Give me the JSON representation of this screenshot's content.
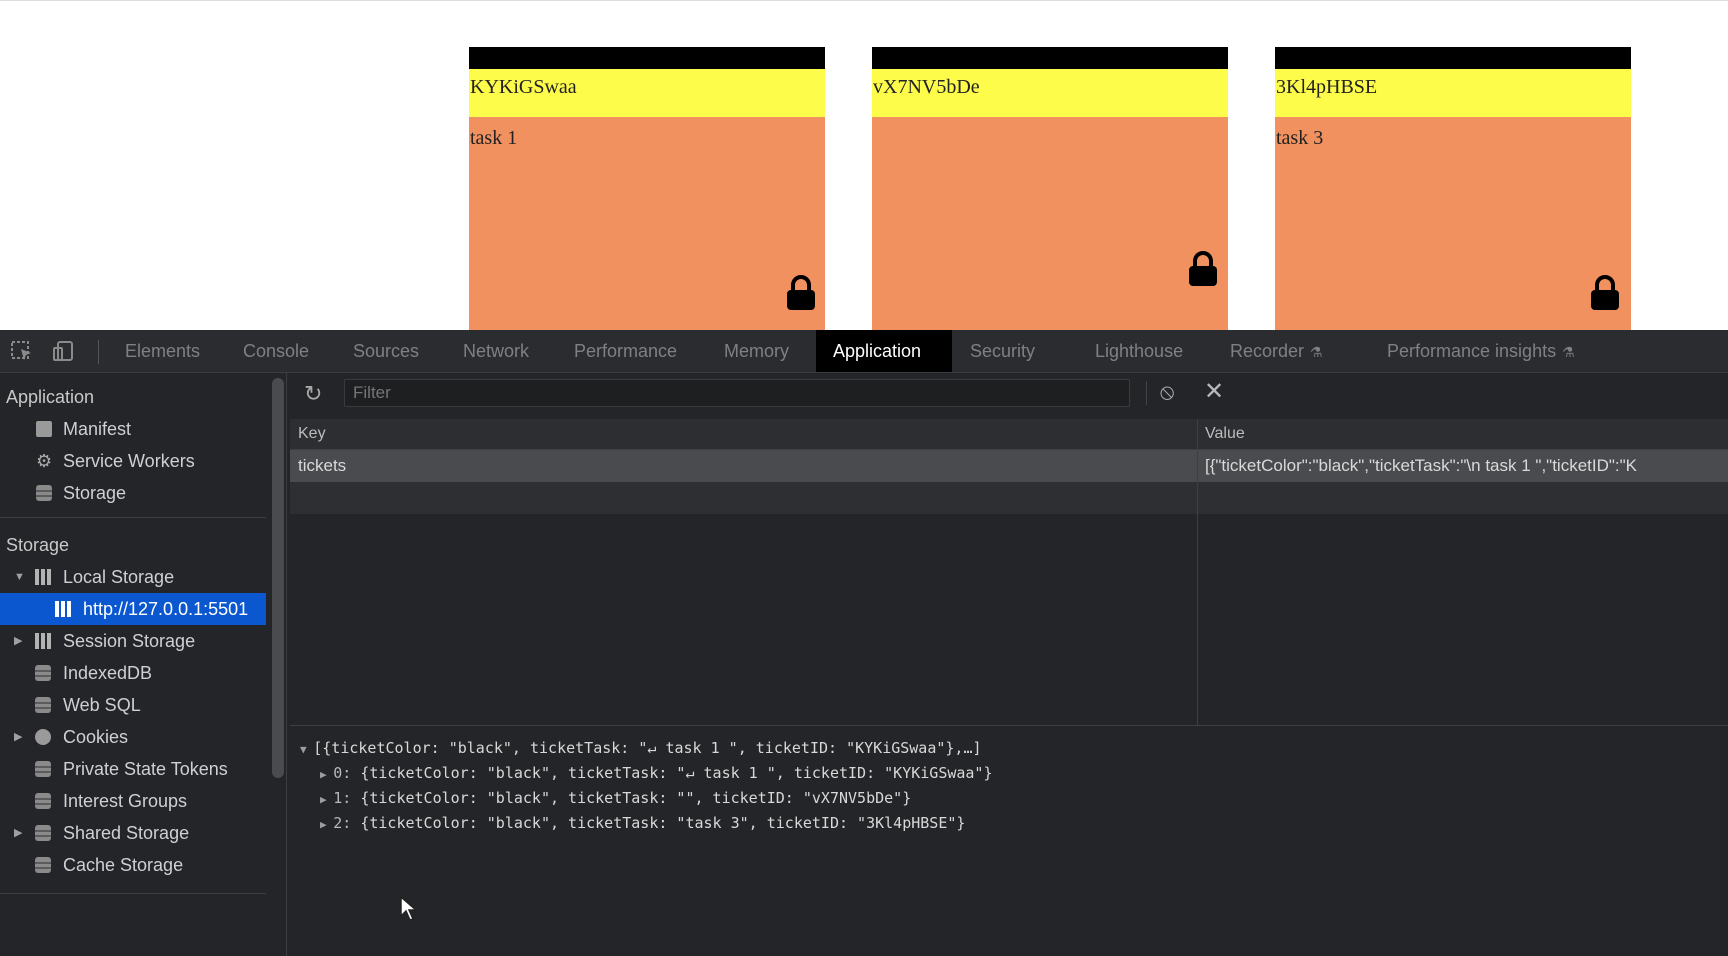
{
  "page": {
    "tickets": [
      {
        "id": "KYKiGSwaa",
        "task": "task 1",
        "strip_color": "#000000",
        "id_bg": "#fefc4a",
        "body_bg": "#f0915f",
        "lock_icon": "lock-icon"
      },
      {
        "id": "vX7NV5bDe",
        "task": "",
        "strip_color": "#000000",
        "id_bg": "#fefc4a",
        "body_bg": "#f0915f",
        "lock_icon": "lock-icon"
      },
      {
        "id": "3Kl4pHBSE",
        "task": "task 3",
        "strip_color": "#000000",
        "id_bg": "#fefc4a",
        "body_bg": "#f0915f",
        "lock_icon": "lock-icon"
      }
    ]
  },
  "devtools": {
    "toolbar_icons": [
      "inspect-element-icon",
      "device-toolbar-icon"
    ],
    "tabs": [
      {
        "label": "Elements"
      },
      {
        "label": "Console"
      },
      {
        "label": "Sources"
      },
      {
        "label": "Network"
      },
      {
        "label": "Performance"
      },
      {
        "label": "Memory"
      },
      {
        "label": "Application",
        "active": true
      },
      {
        "label": "Security"
      },
      {
        "label": "Lighthouse"
      },
      {
        "label": "Recorder",
        "icon": "flask-icon"
      },
      {
        "label": "Performance insights",
        "icon": "flask-icon"
      }
    ],
    "sidebar": {
      "application_title": "Application",
      "application_items": [
        {
          "label": "Manifest",
          "icon": "document-icon"
        },
        {
          "label": "Service Workers",
          "icon": "gear-icon"
        },
        {
          "label": "Storage",
          "icon": "database-icon"
        }
      ],
      "storage_title": "Storage",
      "storage_items": [
        {
          "label": "Local Storage",
          "icon": "grid-icon",
          "expanded": true
        },
        {
          "label": "http://127.0.0.1:5501",
          "icon": "grid-icon",
          "selected": true
        },
        {
          "label": "Session Storage",
          "icon": "grid-icon"
        },
        {
          "label": "IndexedDB",
          "icon": "database-icon"
        },
        {
          "label": "Web SQL",
          "icon": "database-icon"
        },
        {
          "label": "Cookies",
          "icon": "cookie-icon"
        },
        {
          "label": "Private State Tokens",
          "icon": "database-icon"
        },
        {
          "label": "Interest Groups",
          "icon": "database-icon"
        },
        {
          "label": "Shared Storage",
          "icon": "database-icon"
        },
        {
          "label": "Cache Storage",
          "icon": "database-icon"
        }
      ],
      "selected_color": "#0b57d0"
    },
    "storage": {
      "filter_placeholder": "Filter",
      "columns": {
        "key": "Key",
        "value": "Value"
      },
      "rows": [
        {
          "key": "tickets",
          "value": "[{\"ticketColor\":\"black\",\"ticketTask\":\"\\n task 1 \",\"ticketID\":\"K"
        }
      ],
      "preview": {
        "summary": "[{ticketColor: \"black\", ticketTask: \"↵ task 1 \", ticketID: \"KYKiGSwaa\"},…]",
        "items": [
          {
            "index": "0:",
            "text": "{ticketColor: \"black\", ticketTask: \"↵ task 1 \", ticketID: \"KYKiGSwaa\"}"
          },
          {
            "index": "1:",
            "text": "{ticketColor: \"black\", ticketTask: \"\", ticketID: \"vX7NV5bDe\"}"
          },
          {
            "index": "2:",
            "text": "{ticketColor: \"black\", ticketTask: \"task 3\", ticketID: \"3Kl4pHBSE\"}"
          }
        ]
      }
    }
  }
}
